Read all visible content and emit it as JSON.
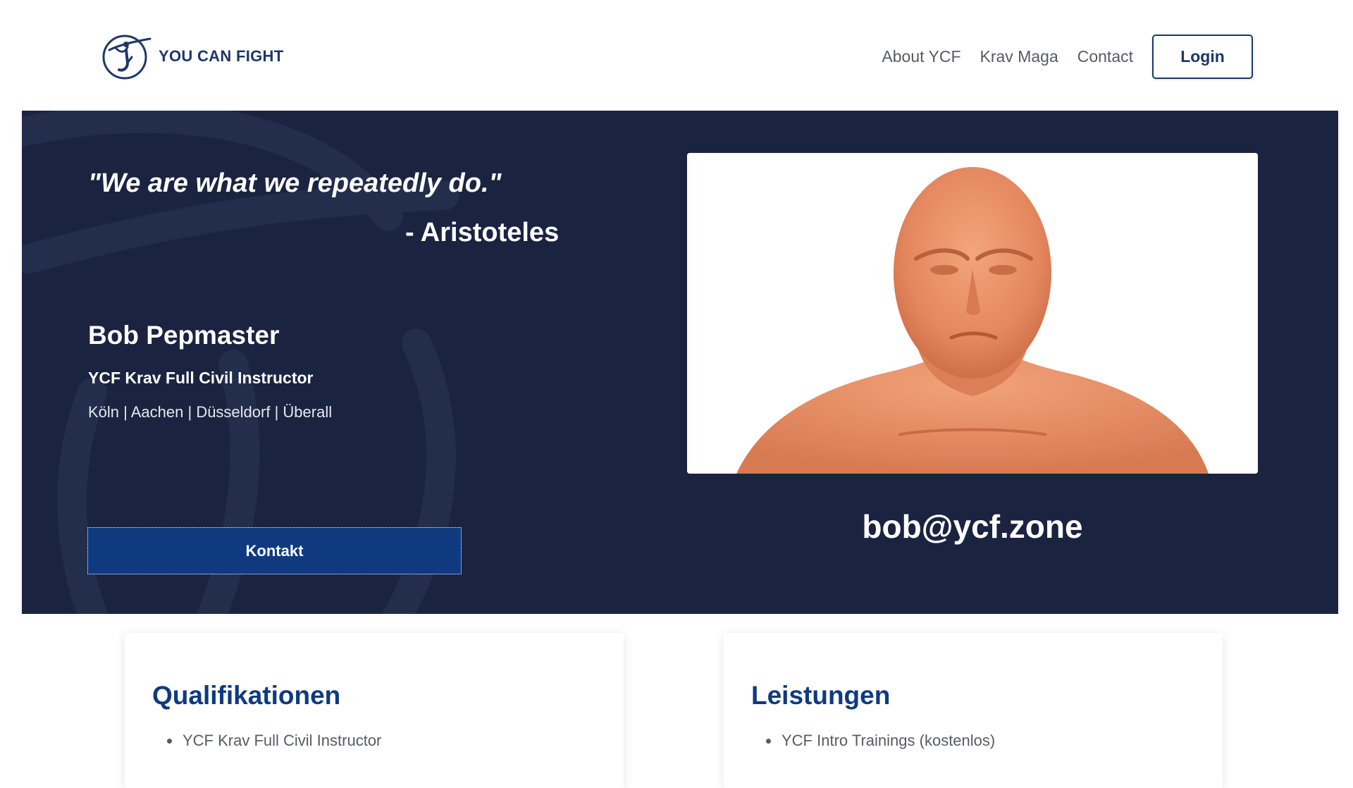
{
  "brand": {
    "name": "YOU CAN FIGHT"
  },
  "nav": {
    "items": [
      "About YCF",
      "Krav Maga",
      "Contact"
    ],
    "login_label": "Login"
  },
  "hero": {
    "quote": "\"We are what we repeatedly do.\"",
    "quote_author": "- Aristoteles",
    "name": "Bob Pepmaster",
    "title": "YCF Krav Full Civil Instructor",
    "locations": "Köln | Aachen | Düsseldorf | Überall",
    "contact_button": "Kontakt",
    "email": "bob@ycf.zone"
  },
  "cards": {
    "qualifications": {
      "title": "Qualifikationen",
      "items": [
        "YCF Krav Full Civil Instructor"
      ]
    },
    "services": {
      "title": "Leistungen",
      "items": [
        "YCF Intro Trainings (kostenlos)"
      ]
    }
  },
  "colors": {
    "navy_bg": "#1a2340",
    "brand_blue": "#0f3a80",
    "logo_blue": "#1d3768",
    "nav_gray": "#555c66"
  }
}
